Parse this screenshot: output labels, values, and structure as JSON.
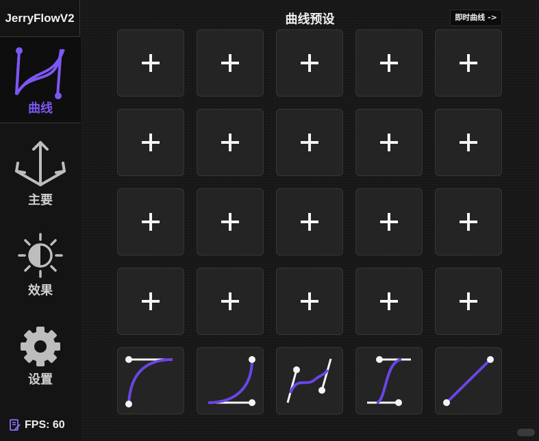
{
  "app": {
    "brand": "JerryFlowV2",
    "fps_label": "FPS: 60"
  },
  "sidebar": {
    "items": [
      {
        "id": "curve",
        "label": "曲线",
        "icon": "curve-icon",
        "active": true
      },
      {
        "id": "main",
        "label": "主要",
        "icon": "axes-arrows-icon",
        "active": false
      },
      {
        "id": "effects",
        "label": "效果",
        "icon": "brightness-icon",
        "active": false
      },
      {
        "id": "settings",
        "label": "设置",
        "icon": "gear-icon",
        "active": false
      }
    ]
  },
  "header": {
    "title": "曲线预设",
    "realtime_button": "即时曲线 ->"
  },
  "presets": {
    "empty_icon": "plus-icon",
    "empty_rows": 4,
    "columns": 5,
    "curves": [
      "ease-out-icon",
      "ease-in-icon",
      "bezier-s-icon",
      "ease-in-out-icon",
      "linear-icon"
    ]
  },
  "colors": {
    "accent": "#7d57f4",
    "curve": "#6a46e6",
    "background": "#171717",
    "tile": "#242424"
  }
}
